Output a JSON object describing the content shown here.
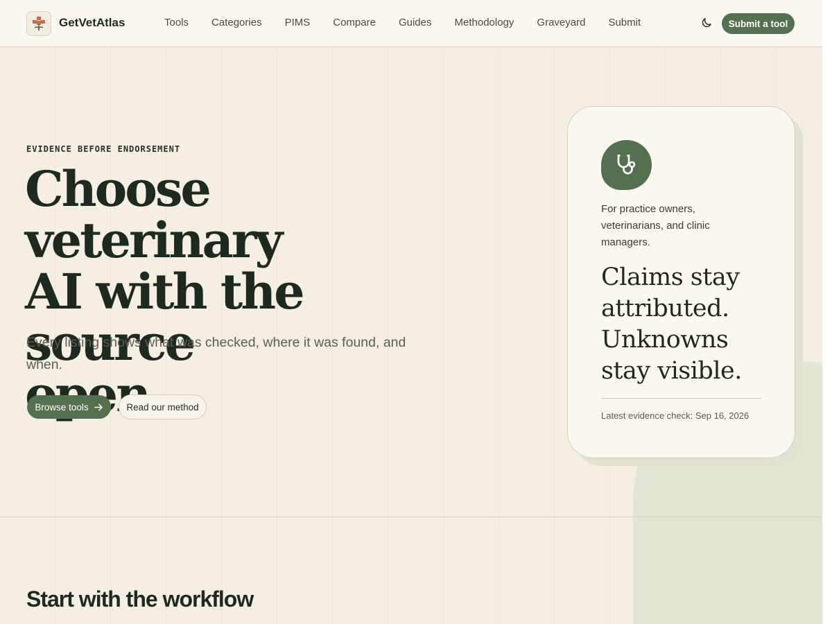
{
  "header": {
    "brand": "GetVetAtlas",
    "nav": [
      "Tools",
      "Categories",
      "PIMS",
      "Compare",
      "Guides",
      "Methodology",
      "Graveyard",
      "Submit"
    ],
    "theme_toggle_icon": "moon-icon",
    "submit_label": "Submit a tool"
  },
  "hero": {
    "eyebrow": "EVIDENCE BEFORE ENDORSEMENT",
    "title_lines": [
      "Choose veterinary",
      "AI with the source",
      "open."
    ],
    "subtitle": "Every listing shows what was checked, where it was found, and when.",
    "primary_cta": "Browse tools",
    "primary_cta_icon": "arrow-right-icon",
    "secondary_cta": "Read our method"
  },
  "card": {
    "icon": "stethoscope-icon",
    "audience": "For practice owners, veterinarians, and clinic managers.",
    "quote_lines": [
      "Claims stay",
      "attributed.",
      "Unknowns",
      "stay visible."
    ],
    "latest_check": "Latest evidence check: Sep 16, 2026"
  },
  "section": {
    "title": "Start with the workflow"
  },
  "colors": {
    "accent": "#55704f",
    "background": "#f5efe3",
    "text": "#1e2a1f"
  }
}
